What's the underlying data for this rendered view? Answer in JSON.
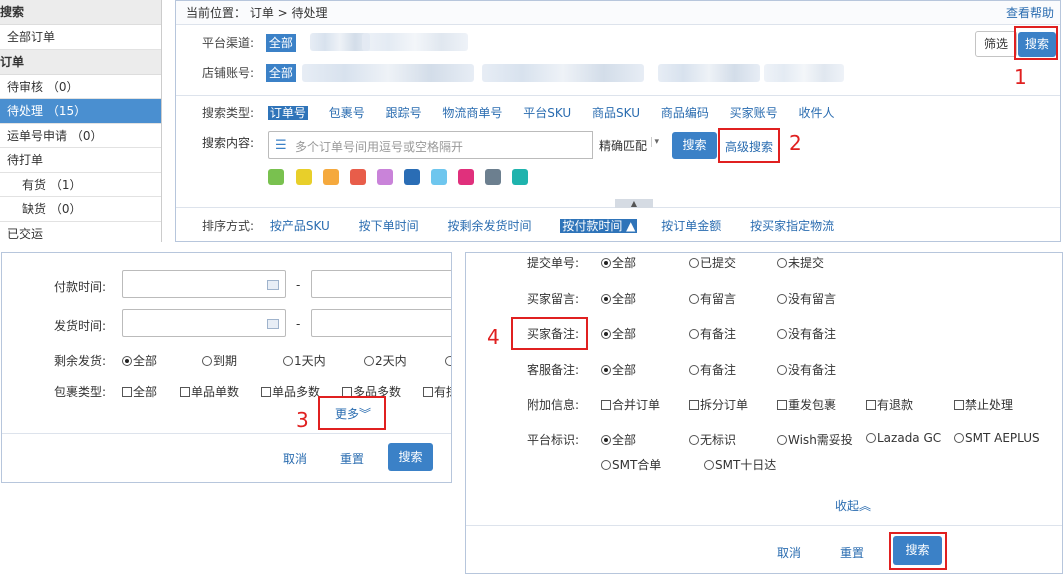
{
  "sidebar": {
    "section1": "搜索",
    "all_orders": "全部订单",
    "section2": "订单",
    "items": [
      {
        "label": "待审核 （0）"
      },
      {
        "label": "待处理 （15）"
      },
      {
        "label": "运单号申请 （0）"
      },
      {
        "label": "待打单"
      },
      {
        "label": "有货 （1）"
      },
      {
        "label": "缺货 （0）"
      },
      {
        "label": "已交运"
      }
    ]
  },
  "header": {
    "breadcrumb": "当前位置： 订单 > 待处理",
    "help": "查看帮助"
  },
  "filters": {
    "platform_label": "平台渠道:",
    "platform_value": "全部",
    "store_label": "店铺账号:",
    "store_value": "全部",
    "filter_btn": "筛选",
    "search_btn": "搜索"
  },
  "search": {
    "type_label": "搜索类型:",
    "types": [
      "订单号",
      "包裹号",
      "跟踪号",
      "物流商单号",
      "平台SKU",
      "商品SKU",
      "商品编码",
      "买家账号",
      "收件人"
    ],
    "content_label": "搜索内容:",
    "placeholder": "多个订单号间用逗号或空格隔开",
    "match": "精确匹配",
    "search_btn": "搜索",
    "advanced": "高级搜索",
    "colors": [
      "#79c14f",
      "#e8cf2a",
      "#f5a93d",
      "#e85d4a",
      "#c983d9",
      "#2a6db5",
      "#6ec6ee",
      "#e0307c",
      "#6c7f8f",
      "#1fb3ad"
    ]
  },
  "sort": {
    "label": "排序方式:",
    "options": [
      "按产品SKU",
      "按下单时间",
      "按剩余发货时间",
      "按付款时间 ▲",
      "按订单金额",
      "按买家指定物流"
    ]
  },
  "left_panel": {
    "pay_time": "付款时间:",
    "ship_time": "发货时间:",
    "dash": "-",
    "remaining_label": "剩余发货:",
    "remaining": [
      "全部",
      "到期",
      "1天内",
      "2天内",
      "3天"
    ],
    "package_label": "包裹类型:",
    "package": [
      "全部",
      "单品单数",
      "单品多数",
      "多品多数",
      "有拣货"
    ],
    "more": "更多︾",
    "cancel": "取消",
    "reset": "重置",
    "search": "搜索"
  },
  "right_panel": {
    "submit_label": "提交单号:",
    "submit": [
      "全部",
      "已提交",
      "未提交"
    ],
    "buyer_msg_label": "买家留言:",
    "buyer_msg": [
      "全部",
      "有留言",
      "没有留言"
    ],
    "buyer_note_label": "买家备注:",
    "buyer_note": [
      "全部",
      "有备注",
      "没有备注"
    ],
    "cs_note_label": "客服备注:",
    "cs_note": [
      "全部",
      "有备注",
      "没有备注"
    ],
    "extra_label": "附加信息:",
    "extra": [
      "合并订单",
      "拆分订单",
      "重发包裹",
      "有退款",
      "禁止处理"
    ],
    "platform_label": "平台标识:",
    "platform": [
      "全部",
      "无标识",
      "Wish需妥投",
      "Lazada GC",
      "SMT AEPLUS",
      "SMT合单",
      "SMT十日达"
    ],
    "collapse": "收起︽",
    "cancel": "取消",
    "reset": "重置",
    "search": "搜索"
  },
  "annotations": [
    "1",
    "2",
    "3",
    "4"
  ]
}
